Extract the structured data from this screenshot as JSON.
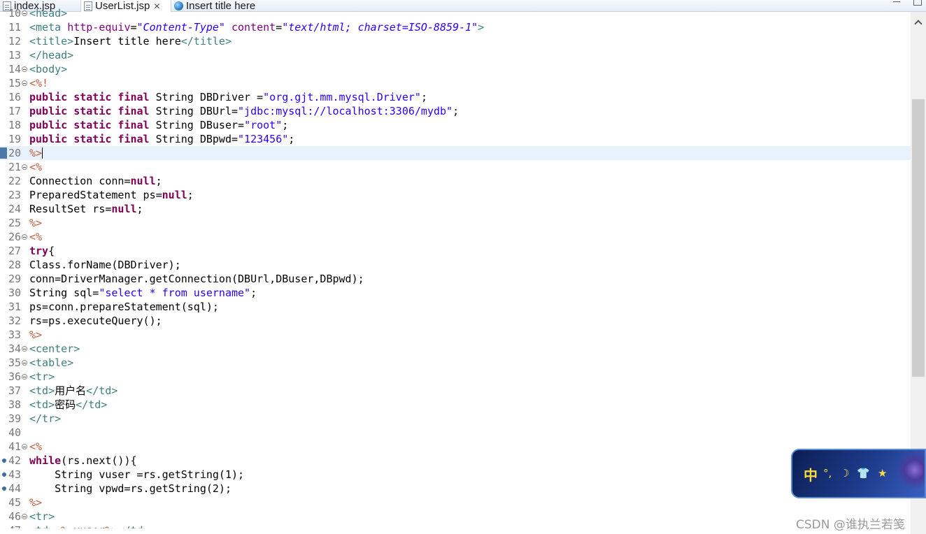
{
  "tabs": [
    {
      "label": "index.jsp",
      "icon": "file-icon",
      "active": false
    },
    {
      "label": "UserList.jsp",
      "icon": "file-icon",
      "active": true,
      "close": "✕"
    },
    {
      "label": "Insert title here",
      "icon": "globe-icon",
      "active": false
    }
  ],
  "editor": {
    "lines": [
      {
        "n": "10",
        "t": "<head>"
      },
      {
        "n": "11",
        "t": "<meta http-equiv=\"Content-Type\" content=\"text/html; charset=ISO-8859-1\">"
      },
      {
        "n": "12",
        "t": "<title>Insert title here</title>"
      },
      {
        "n": "13",
        "t": "</head>"
      },
      {
        "n": "14",
        "t": "<body>"
      },
      {
        "n": "15",
        "t": "<%!"
      },
      {
        "n": "16",
        "t": "public static final String DBDriver =\"org.gjt.mm.mysql.Driver\";"
      },
      {
        "n": "17",
        "t": "public static final String DBUrl=\"jdbc:mysql://localhost:3306/mydb\";"
      },
      {
        "n": "18",
        "t": "public static final String DBuser=\"root\";"
      },
      {
        "n": "19",
        "t": "public static final String DBpwd=\"123456\";"
      },
      {
        "n": "20",
        "t": "%>"
      },
      {
        "n": "21",
        "t": "<%"
      },
      {
        "n": "22",
        "t": "Connection conn=null;"
      },
      {
        "n": "23",
        "t": "PreparedStatement ps=null;"
      },
      {
        "n": "24",
        "t": "ResultSet rs=null;"
      },
      {
        "n": "25",
        "t": "%>"
      },
      {
        "n": "26",
        "t": "<%"
      },
      {
        "n": "27",
        "t": "try{"
      },
      {
        "n": "28",
        "t": "Class.forName(DBDriver);"
      },
      {
        "n": "29",
        "t": "conn=DriverManager.getConnection(DBUrl,DBuser,DBpwd);"
      },
      {
        "n": "30",
        "t": "String sql=\"select * from username\";"
      },
      {
        "n": "31",
        "t": "ps=conn.prepareStatement(sql);"
      },
      {
        "n": "32",
        "t": "rs=ps.executeQuery();"
      },
      {
        "n": "33",
        "t": "%>"
      },
      {
        "n": "34",
        "t": "<center>"
      },
      {
        "n": "35",
        "t": "<table>"
      },
      {
        "n": "36",
        "t": "<tr>"
      },
      {
        "n": "37",
        "t": "<td>用户名</td>"
      },
      {
        "n": "38",
        "t": "<td>密码</td>"
      },
      {
        "n": "39",
        "t": "</tr>"
      },
      {
        "n": "40",
        "t": ""
      },
      {
        "n": "41",
        "t": "<%"
      },
      {
        "n": "42",
        "t": "while(rs.next()){"
      },
      {
        "n": "43",
        "t": "    String vuser =rs.getString(1);"
      },
      {
        "n": "44",
        "t": "    String vpwd=rs.getString(2);"
      },
      {
        "n": "45",
        "t": "%>"
      },
      {
        "n": "46",
        "t": "<tr>"
      },
      {
        "n": "47",
        "t": "<td><%=vuser%></td>"
      }
    ]
  },
  "ime": {
    "mode": "中",
    "glyphs": [
      "°,",
      "☽",
      "👕",
      "★"
    ]
  },
  "watermark": "CSDN @谁执兰若笺"
}
